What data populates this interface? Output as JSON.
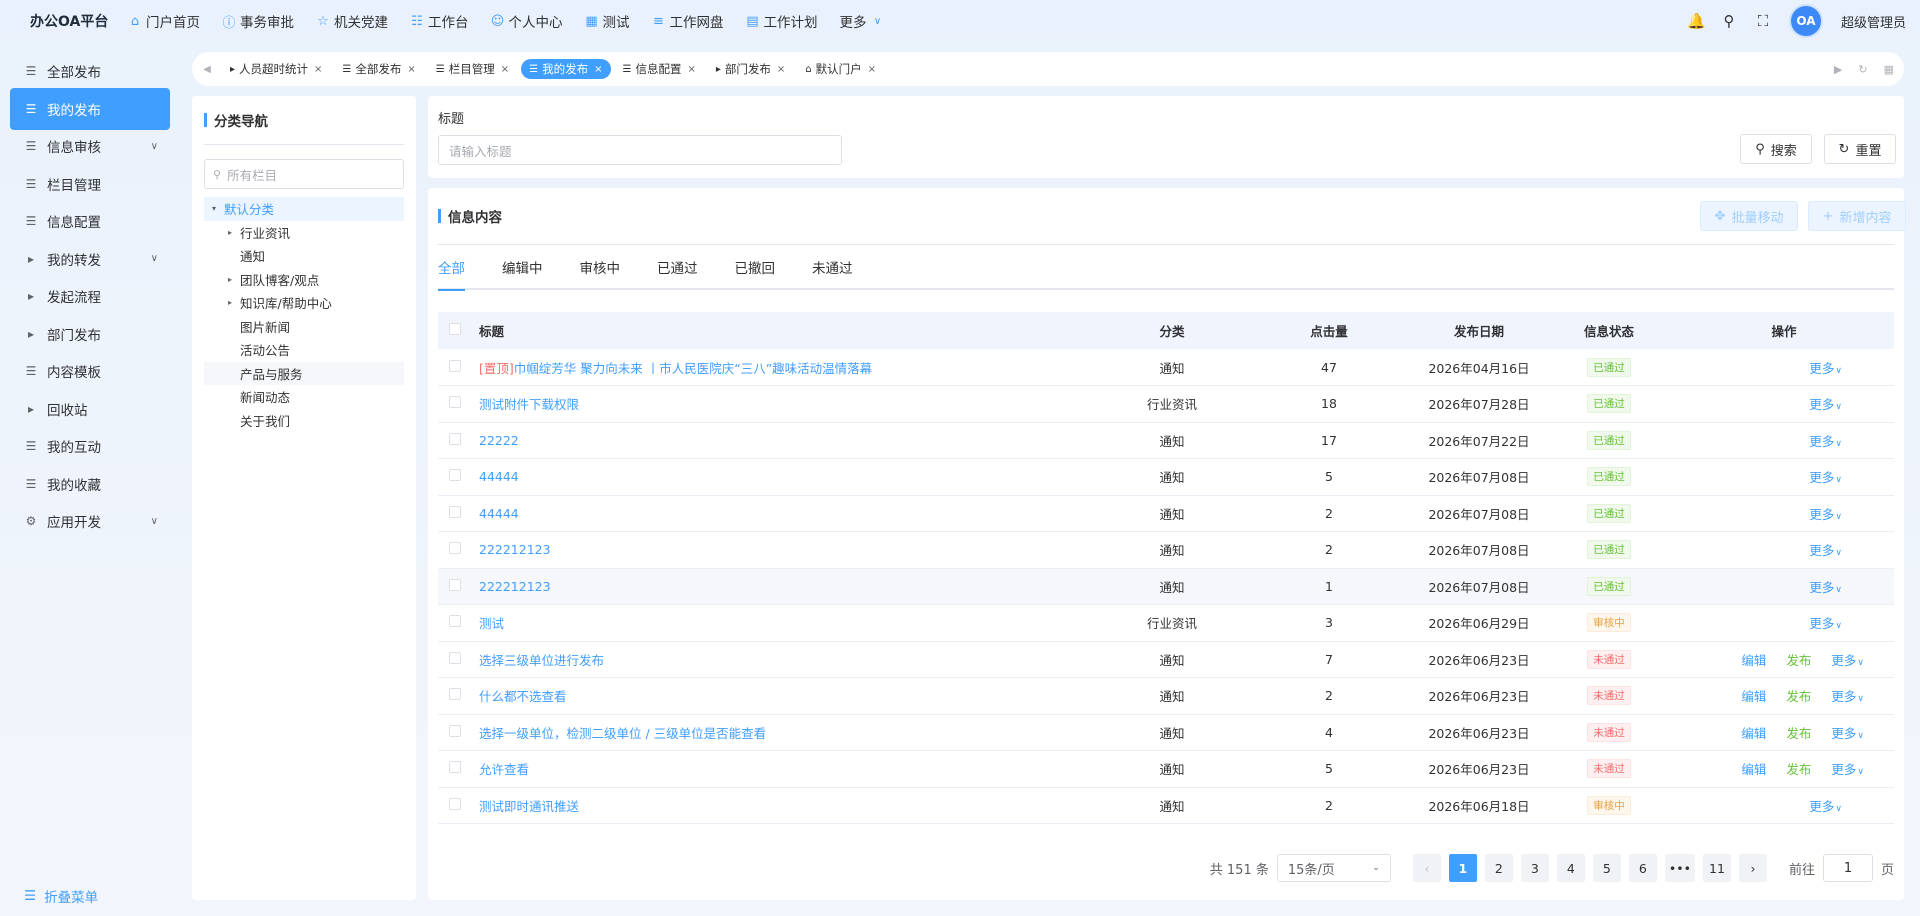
{
  "app": {
    "title": "办公OA平台",
    "user_name": "超级管理员",
    "avatar_text": "OA"
  },
  "top_nav": [
    {
      "label": "门户首页",
      "icon": "home-icon"
    },
    {
      "label": "事务审批",
      "icon": "info-icon"
    },
    {
      "label": "机关党建",
      "icon": "star-icon"
    },
    {
      "label": "工作台",
      "icon": "org-icon"
    },
    {
      "label": "个人中心",
      "icon": "user-icon"
    },
    {
      "label": "测试",
      "icon": "grid-icon"
    },
    {
      "label": "工作网盘",
      "icon": "database-icon"
    },
    {
      "label": "工作计划",
      "icon": "calendar-icon"
    },
    {
      "label": "更多",
      "icon": "chevron-down-icon"
    }
  ],
  "sidebar": {
    "items": [
      {
        "label": "全部发布",
        "icon": "document-icon"
      },
      {
        "label": "我的发布",
        "icon": "document-icon",
        "active": true
      },
      {
        "label": "信息审核",
        "icon": "document-icon",
        "expandable": true
      },
      {
        "label": "栏目管理",
        "icon": "document-icon"
      },
      {
        "label": "信息配置",
        "icon": "document-icon"
      },
      {
        "label": "我的转发",
        "icon": "caret-right-icon",
        "expandable": true
      },
      {
        "label": "发起流程",
        "icon": "caret-right-icon"
      },
      {
        "label": "部门发布",
        "icon": "caret-right-icon"
      },
      {
        "label": "内容模板",
        "icon": "document-icon"
      },
      {
        "label": "回收站",
        "icon": "caret-right-icon"
      },
      {
        "label": "我的互动",
        "icon": "document-icon"
      },
      {
        "label": "我的收藏",
        "icon": "document-icon"
      },
      {
        "label": "应用开发",
        "icon": "gear-icon",
        "expandable": true
      }
    ],
    "collapse_label": "折叠菜单"
  },
  "tabs": [
    {
      "label": "人员超时统计",
      "icon": "caret-right-icon"
    },
    {
      "label": "全部发布",
      "icon": "document-icon"
    },
    {
      "label": "栏目管理",
      "icon": "document-icon"
    },
    {
      "label": "我的发布",
      "icon": "document-icon",
      "active": true
    },
    {
      "label": "信息配置",
      "icon": "document-icon"
    },
    {
      "label": "部门发布",
      "icon": "caret-right-icon"
    },
    {
      "label": "默认门户",
      "icon": "home-icon"
    }
  ],
  "tree": {
    "title": "分类导航",
    "search_placeholder": "所有栏目",
    "nodes": [
      {
        "label": "默认分类",
        "level": 0,
        "expanded": true,
        "selected": true
      },
      {
        "label": "行业资讯",
        "level": 1,
        "has_children": true
      },
      {
        "label": "通知",
        "level": 1
      },
      {
        "label": "团队博客/观点",
        "level": 1,
        "has_children": true
      },
      {
        "label": "知识库/帮助中心",
        "level": 1,
        "has_children": true
      },
      {
        "label": "图片新闻",
        "level": 1
      },
      {
        "label": "活动公告",
        "level": 1
      },
      {
        "label": "产品与服务",
        "level": 1,
        "hover": true
      },
      {
        "label": "新闻动态",
        "level": 1
      },
      {
        "label": "关于我们",
        "level": 1
      }
    ]
  },
  "search": {
    "field_label": "标题",
    "placeholder": "请输入标题",
    "search_button": "搜索",
    "reset_button": "重置"
  },
  "content": {
    "title": "信息内容",
    "batch_move_button": "批量移动",
    "add_button": "新增内容",
    "status_tabs": [
      "全部",
      "编辑中",
      "审核中",
      "已通过",
      "已撤回",
      "未通过"
    ],
    "active_status_tab": 0,
    "columns": {
      "title": "标题",
      "category": "分类",
      "clicks": "点击量",
      "date": "发布日期",
      "status": "信息状态",
      "ops": "操作"
    },
    "op_labels": {
      "edit": "编辑",
      "publish": "发布",
      "more": "更多"
    },
    "rows": [
      {
        "pin": "[置顶]",
        "title": "巾帼绽芳华 聚力向未来 丨市人民医院庆“三八”趣味活动温情落幕",
        "category": "通知",
        "clicks": "47",
        "date": "2026年04月16日",
        "status": "已通过",
        "status_type": "pass"
      },
      {
        "pin": "",
        "title": "测试附件下载权限",
        "category": "行业资讯",
        "clicks": "18",
        "date": "2026年07月28日",
        "status": "已通过",
        "status_type": "pass"
      },
      {
        "pin": "",
        "title": "22222",
        "category": "通知",
        "clicks": "17",
        "date": "2026年07月22日",
        "status": "已通过",
        "status_type": "pass"
      },
      {
        "pin": "",
        "title": "44444",
        "category": "通知",
        "clicks": "5",
        "date": "2026年07月08日",
        "status": "已通过",
        "status_type": "pass"
      },
      {
        "pin": "",
        "title": "44444",
        "category": "通知",
        "clicks": "2",
        "date": "2026年07月08日",
        "status": "已通过",
        "status_type": "pass"
      },
      {
        "pin": "",
        "title": "222212123",
        "category": "通知",
        "clicks": "2",
        "date": "2026年07月08日",
        "status": "已通过",
        "status_type": "pass"
      },
      {
        "pin": "",
        "title": "222212123",
        "category": "通知",
        "clicks": "1",
        "date": "2026年07月08日",
        "status": "已通过",
        "status_type": "pass",
        "highlight": true
      },
      {
        "pin": "",
        "title": "测试",
        "category": "行业资讯",
        "clicks": "3",
        "date": "2026年06月29日",
        "status": "审核中",
        "status_type": "review"
      },
      {
        "pin": "",
        "title": "选择三级单位进行发布",
        "category": "通知",
        "clicks": "7",
        "date": "2026年06月23日",
        "status": "未通过",
        "status_type": "fail"
      },
      {
        "pin": "",
        "title": "什么都不选查看",
        "category": "通知",
        "clicks": "2",
        "date": "2026年06月23日",
        "status": "未通过",
        "status_type": "fail"
      },
      {
        "pin": "",
        "title": "选择一级单位，检测二级单位 / 三级单位是否能查看",
        "category": "通知",
        "clicks": "4",
        "date": "2026年06月23日",
        "status": "未通过",
        "status_type": "fail"
      },
      {
        "pin": "",
        "title": "允许查看",
        "category": "通知",
        "clicks": "5",
        "date": "2026年06月23日",
        "status": "未通过",
        "status_type": "fail"
      },
      {
        "pin": "",
        "title": "测试即时通讯推送",
        "category": "通知",
        "clicks": "2",
        "date": "2026年06月18日",
        "status": "审核中",
        "status_type": "review"
      }
    ]
  },
  "pagination": {
    "total_text": "共 151 条",
    "page_size": "15条/页",
    "pages": [
      "1",
      "2",
      "3",
      "4",
      "5",
      "6",
      "•••",
      "11"
    ],
    "current_page": "1",
    "goto_label": "前往",
    "goto_value": "1",
    "page_suffix": "页"
  },
  "colors": {
    "accent": "#409eff",
    "pass": "#67c23a",
    "review": "#e6a23c",
    "fail": "#f56c6c"
  }
}
